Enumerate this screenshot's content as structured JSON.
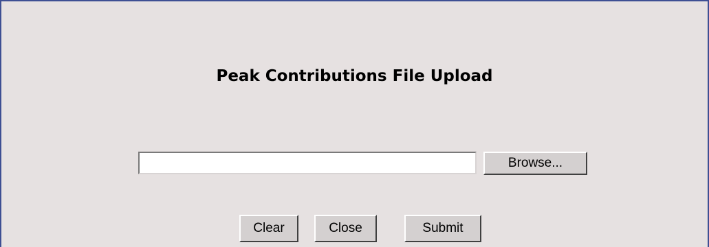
{
  "dialog": {
    "title": "Peak Contributions File Upload"
  },
  "file_field": {
    "value": "",
    "browse_label": "Browse..."
  },
  "actions": {
    "clear_label": "Clear",
    "close_label": "Close",
    "submit_label": "Submit"
  },
  "colors": {
    "panel_background": "#e6e1e1",
    "panel_border": "#3e4f93",
    "button_face": "#d4d0d0"
  }
}
